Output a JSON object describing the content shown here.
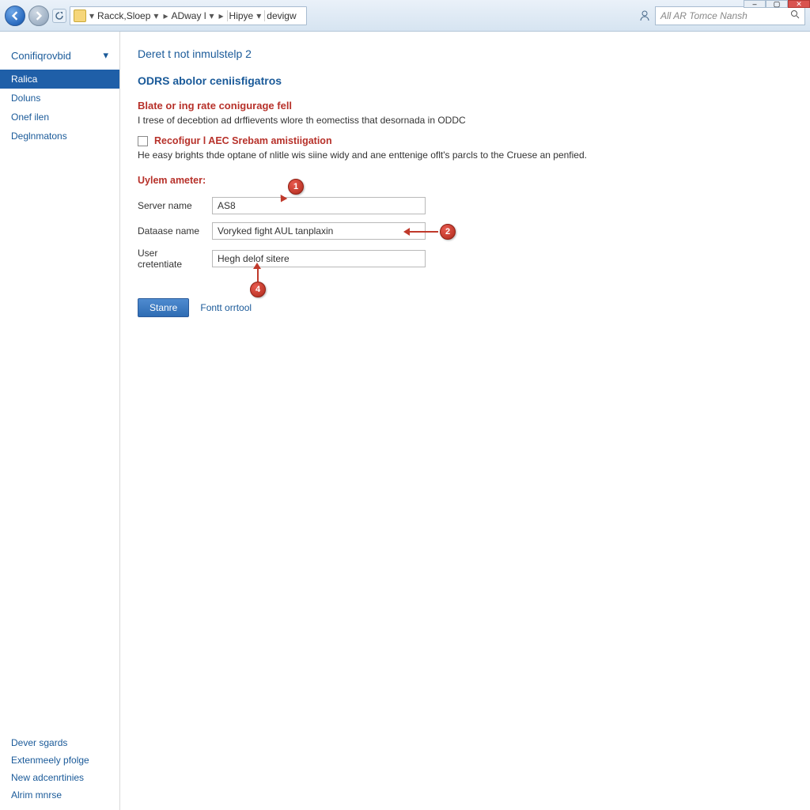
{
  "window": {
    "min": "–",
    "max": "▢",
    "close": "✕"
  },
  "breadcrumb": {
    "seg1": "Racck,Sloep",
    "seg2": "ADway l",
    "seg3": "Hipye",
    "seg4": "devigw"
  },
  "search": {
    "placeholder": "All AR Tomce Nansh"
  },
  "sidebar": {
    "header": "Conifiqrovbid",
    "items": [
      "Ralica",
      "Doluns",
      "Onef ilen",
      "Deglnmatons"
    ],
    "bottom": [
      "Dever sgards",
      "Extenmeely pfolge",
      "New adcenrtinies",
      "Alrim mnrse"
    ]
  },
  "page": {
    "title": "Deret t not inmulstelp 2",
    "section": "ODRS abolor ceniisfigatros",
    "redhead": "Blate or ing rate conigurage fell",
    "desc": "I trese of decebtion ad drffievents wlore th eomectiss that desornada in ODDC",
    "chklabel": "Recofigur l AEC Srebam amistiigation",
    "note": "He easy brights thde optane of nlitle wis siine widy and ane enttenige oflt's parcls to the Cruese an penfied.",
    "paramhead": "Uylem ameter:",
    "fields": {
      "server_label": "Server name",
      "server_value": "AS8",
      "db_label": "Dataase name",
      "db_value": "Voryked fight AUL tanplaxin",
      "user_label": "User cretentiate",
      "user_value": "Hegh delof sitere"
    },
    "save": "Stanre",
    "cancel": "Fontt orrtool"
  },
  "callouts": {
    "c1": "1",
    "c2": "2",
    "c4": "4"
  }
}
